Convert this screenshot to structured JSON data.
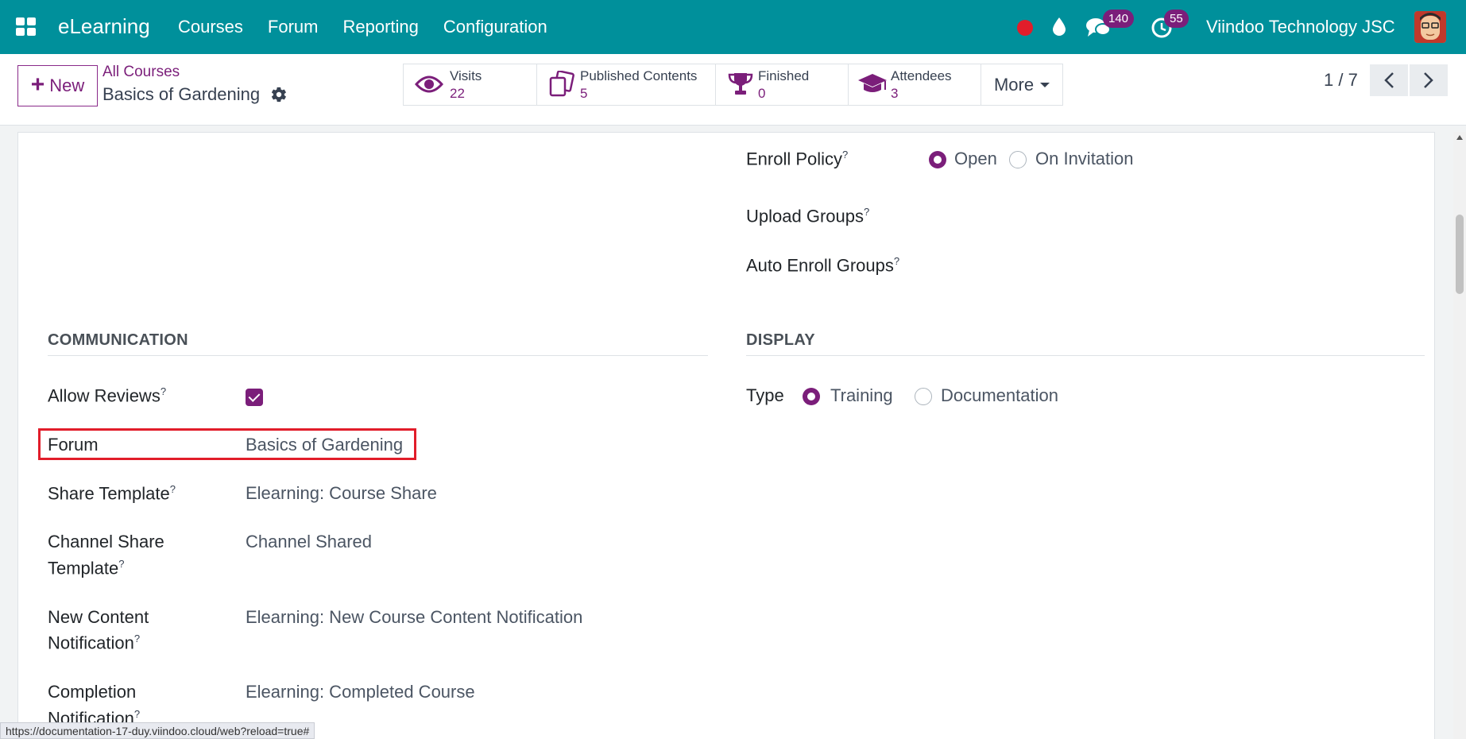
{
  "navbar": {
    "app_name": "eLearning",
    "menu": [
      "Courses",
      "Forum",
      "Reporting",
      "Configuration"
    ],
    "messages_count": "140",
    "activities_count": "55",
    "company": "Viindoo Technology JSC",
    "color": "#00909b"
  },
  "control_panel": {
    "new_label": "New",
    "breadcrumb_parent": "All Courses",
    "breadcrumb_current": "Basics of Gardening",
    "stats": [
      {
        "label": "Visits",
        "value": "22",
        "icon": "eye-icon"
      },
      {
        "label": "Published Contents",
        "value": "5",
        "icon": "documents-icon"
      },
      {
        "label": "Finished",
        "value": "0",
        "icon": "trophy-icon"
      },
      {
        "label": "Attendees",
        "value": "3",
        "icon": "graduation-cap-icon"
      }
    ],
    "more_label": "More",
    "pager": "1 / 7"
  },
  "form": {
    "enroll_policy": {
      "label": "Enroll Policy",
      "options": [
        "Open",
        "On Invitation"
      ],
      "selected": "Open"
    },
    "upload_groups": {
      "label": "Upload Groups"
    },
    "auto_enroll_groups": {
      "label": "Auto Enroll Groups"
    },
    "communication": {
      "title": "COMMUNICATION",
      "allow_reviews": {
        "label": "Allow Reviews",
        "checked": true
      },
      "forum": {
        "label": "Forum",
        "value": "Basics of Gardening"
      },
      "share_template": {
        "label": "Share Template",
        "value": "Elearning: Course Share"
      },
      "channel_share_template": {
        "label_line1": "Channel Share",
        "label_line2": "Template",
        "value": "Channel Shared"
      },
      "new_content_notification": {
        "label_line1": "New Content",
        "label_line2": "Notification",
        "value": "Elearning: New Course Content Notification"
      },
      "completion_notification": {
        "label_line1": "Completion",
        "label_line2": "Notification",
        "value": "Elearning: Completed Course"
      }
    },
    "display": {
      "title": "DISPLAY",
      "type": {
        "label": "Type",
        "options": [
          "Training",
          "Documentation"
        ],
        "selected": "Training"
      }
    }
  },
  "tooltip_mark": "?",
  "status_url": "https://documentation-17-duy.viindoo.cloud/web?reload=true#",
  "accent_color": "#7b1e7a"
}
